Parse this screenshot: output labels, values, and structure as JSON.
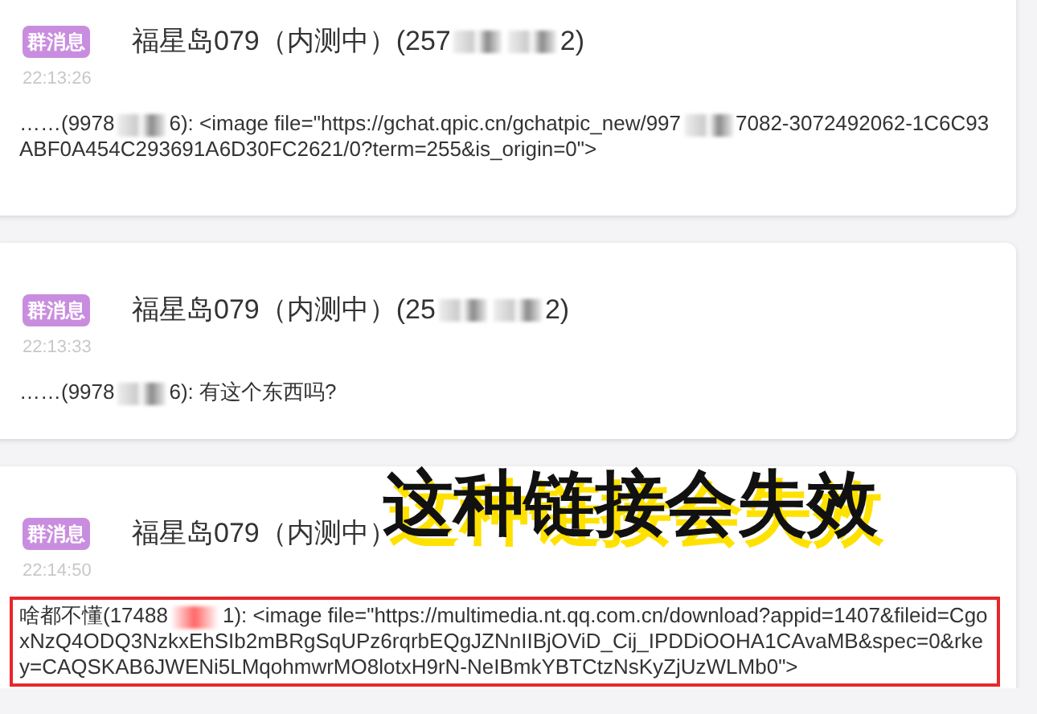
{
  "messages": [
    {
      "badge": "群消息",
      "title": "福星岛079（内测中）(257",
      "title_end": "2)",
      "time": "22:13:26",
      "segments": [
        "……(9978",
        "6): <image file=\"https://gchat.qpic.cn/gchatpic_new/997",
        "7082-3072492062-1C6C93ABF0A454C293691A6D30FC2621/0?term=255&is_origin=0\">"
      ],
      "highlighted": false
    },
    {
      "badge": "群消息",
      "title": "福星岛079（内测中）(25",
      "title_end": "2)",
      "time": "22:13:33",
      "segments": [
        "……(9978",
        "6): 有这个东西吗?"
      ],
      "highlighted": false
    },
    {
      "badge": "群消息",
      "title": "福星岛079（内测中）",
      "time": "22:14:50",
      "segments": [
        "啥都不懂(17488",
        "1): <image file=\"https://multimedia.nt.qq.com.cn/download?appid=1407&fileid=CgoxNzQ4ODQ3NzkxEhSIb2mBRgSqUPz6rqrbEQgJZNnIIBjOViD_Cij_IPDDiOOHA1CAvaMB&spec=0&rkey=CAQSKAB6JWENi5LMqohmwrMO8lotxH9rN-NeIBmkYBTCtzNsKyZjUzWLMb0\">"
      ],
      "highlighted": true,
      "annotation": "这种链接会失效"
    }
  ]
}
